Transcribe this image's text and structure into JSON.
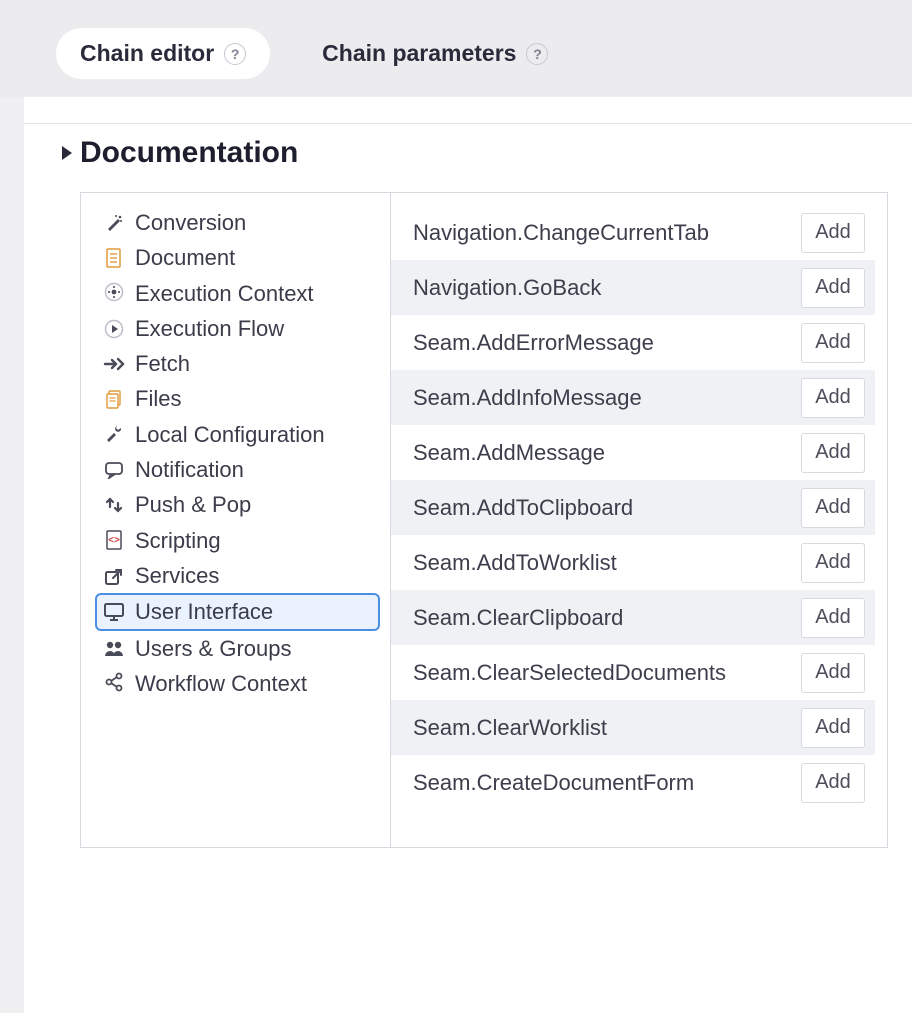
{
  "tabs": {
    "editor": "Chain editor",
    "parameters": "Chain parameters"
  },
  "section": {
    "title": "Documentation"
  },
  "categories": [
    {
      "icon": "wand",
      "label": "Conversion"
    },
    {
      "icon": "doc",
      "label": "Document"
    },
    {
      "icon": "gear-circle",
      "label": "Execution Context"
    },
    {
      "icon": "play-circle",
      "label": "Execution Flow"
    },
    {
      "icon": "arrow-in",
      "label": "Fetch"
    },
    {
      "icon": "files",
      "label": "Files"
    },
    {
      "icon": "tools",
      "label": "Local Configuration"
    },
    {
      "icon": "chat",
      "label": "Notification"
    },
    {
      "icon": "pushpop",
      "label": "Push & Pop"
    },
    {
      "icon": "code-doc",
      "label": "Scripting"
    },
    {
      "icon": "share-box",
      "label": "Services"
    },
    {
      "icon": "monitor",
      "label": "User Interface",
      "selected": true
    },
    {
      "icon": "users",
      "label": "Users & Groups"
    },
    {
      "icon": "share",
      "label": "Workflow Context"
    }
  ],
  "operations": [
    {
      "name": "Navigation.ChangeCurrentTab"
    },
    {
      "name": "Navigation.GoBack"
    },
    {
      "name": "Seam.AddErrorMessage"
    },
    {
      "name": "Seam.AddInfoMessage"
    },
    {
      "name": "Seam.AddMessage"
    },
    {
      "name": "Seam.AddToClipboard"
    },
    {
      "name": "Seam.AddToWorklist"
    },
    {
      "name": "Seam.ClearClipboard"
    },
    {
      "name": "Seam.ClearSelectedDocuments"
    },
    {
      "name": "Seam.ClearWorklist"
    },
    {
      "name": "Seam.CreateDocumentForm"
    }
  ],
  "labels": {
    "add": "Add",
    "help": "?"
  }
}
